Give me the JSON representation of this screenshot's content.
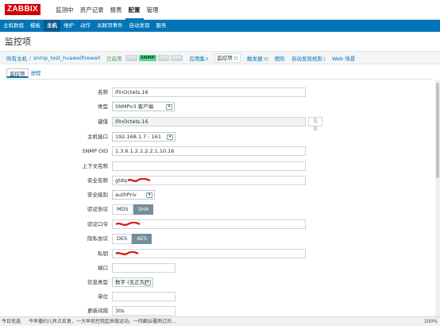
{
  "brand": {
    "logo_text": "ZABBIX",
    "color": "#d40000",
    "accent": "#0275b8"
  },
  "topnav": [
    "监测中",
    "资产记录",
    "报表",
    "配置",
    "管理"
  ],
  "topnav_active": "配置",
  "subnav": [
    "主机群组",
    "模板",
    "主机",
    "维护",
    "动作",
    "关联项事件",
    "自动发现",
    "服务"
  ],
  "subnav_active": "主机",
  "page_title": "监控项",
  "breadcrumb": {
    "all_hosts": "所有主机",
    "separator": "/",
    "host": "snmp_test_huaweifirewall",
    "enabled": "已启用",
    "badges": {
      "zbx": "ZBX",
      "snmp": "SNMP",
      "jmx": "JMX",
      "ipmi": "IPMI"
    },
    "tabs": [
      {
        "label": "应用集",
        "count": "8"
      },
      {
        "label": "监控项",
        "count": "31"
      },
      {
        "label": "触发器",
        "count": "38"
      },
      {
        "label": "图形",
        "count": ""
      },
      {
        "label": "自动发现规则",
        "count": "1"
      },
      {
        "label": "Web 场景",
        "count": ""
      }
    ]
  },
  "form_tabs": [
    "监控项",
    "进程"
  ],
  "form": {
    "name": {
      "label": "名称",
      "value": "ifInOctets.16"
    },
    "type": {
      "label": "类型",
      "value": "SNMPv3 客户端"
    },
    "key": {
      "label": "键值",
      "value": "ifInOctets.16",
      "button": "选择"
    },
    "interface": {
      "label": "主机接口",
      "value": "192.168.1.7 : 161"
    },
    "oid": {
      "label": "SNMP OID",
      "value": "1.3.6.1.2.1.2.2.1.10.16"
    },
    "context": {
      "label": "上下文名称",
      "value": ""
    },
    "security_name": {
      "label": "安全名称",
      "value": "gtdq"
    },
    "security_level": {
      "label": "安全级别",
      "value": "authPriv"
    },
    "auth_protocol": {
      "label": "验证协议",
      "options": [
        "MD5",
        "SHA"
      ],
      "selected": "SHA"
    },
    "auth_pass": {
      "label": "验证口令",
      "value": ""
    },
    "priv_protocol": {
      "label": "隐私协议",
      "options": [
        "DES",
        "AES"
      ],
      "selected": "AES"
    },
    "priv_key": {
      "label": "私钥",
      "value": ""
    },
    "port": {
      "label": "端口",
      "value": ""
    },
    "value_type": {
      "label": "信息类型",
      "value": "数字 (无正负)"
    },
    "units": {
      "label": "单位",
      "value": ""
    },
    "interval": {
      "label": "更新间隔",
      "value": "30s"
    }
  },
  "statusbar": {
    "left": "今日优选",
    "news": "今早播扫儿有点反复，一大早就控我起来做运动，一阵翻云覆雨过后...",
    "zoom": "100%"
  }
}
